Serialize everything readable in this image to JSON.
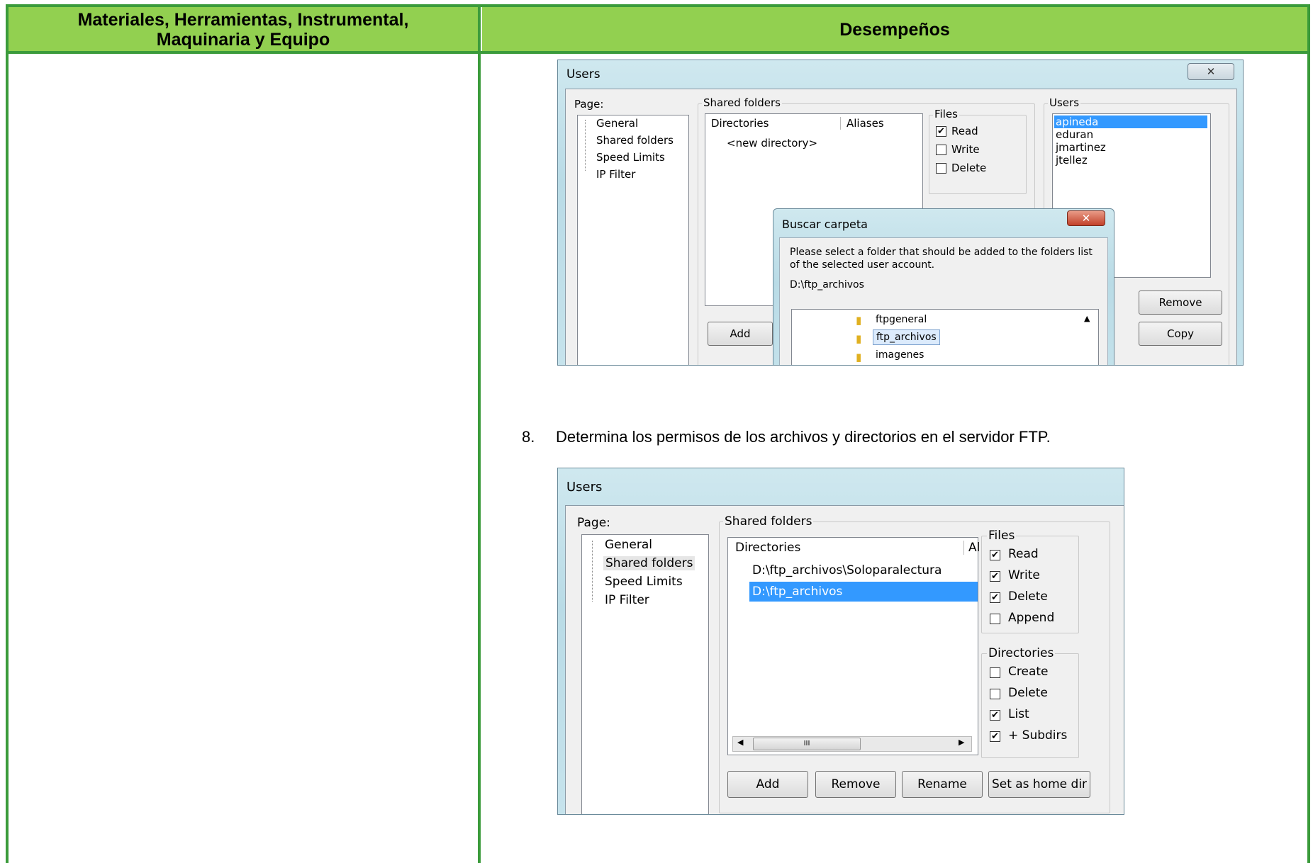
{
  "table": {
    "header_left": "Materiales, Herramientas, Instrumental, Maquinaria y Equipo",
    "header_left_line1": "Materiales, Herramientas, Instrumental,",
    "header_left_line2": "Maquinaria y Equipo",
    "header_right": "Desempeños"
  },
  "step8": {
    "number": "8.",
    "text": "Determina los permisos de los archivos y directorios en el servidor FTP."
  },
  "shot1": {
    "title": "Users",
    "page_label": "Page:",
    "pages": [
      "General",
      "Shared folders",
      "Speed Limits",
      "IP Filter"
    ],
    "shared_folders_label": "Shared folders",
    "col_directories": "Directories",
    "col_aliases": "Aliases",
    "new_directory": "<new directory>",
    "files_label": "Files",
    "files": [
      {
        "label": "Read",
        "checked": true
      },
      {
        "label": "Write",
        "checked": false
      },
      {
        "label": "Delete",
        "checked": false
      }
    ],
    "users_label": "Users",
    "users": [
      "apineda",
      "eduran",
      "jmartinez",
      "jtellez"
    ],
    "add_button": "Add",
    "remove_button": "Remove",
    "copy_button": "Copy",
    "dialog": {
      "title": "Buscar carpeta",
      "message_line1": "Please select a folder that should be added to the folders list",
      "message_line2": "of the selected user account.",
      "path": "D:\\ftp_archivos",
      "folders": [
        "ftpgeneral",
        "ftp_archivos",
        "imagenes"
      ]
    }
  },
  "shot2": {
    "title": "Users",
    "page_label": "Page:",
    "pages": [
      "General",
      "Shared folders",
      "Speed Limits",
      "IP Filter"
    ],
    "shared_folders_label": "Shared folders",
    "col_directories": "Directories",
    "col_aliases": "Al",
    "directories": [
      "D:\\ftp_archivos\\Soloparalectura",
      "D:\\ftp_archivos"
    ],
    "files_label": "Files",
    "files": [
      {
        "label": "Read",
        "checked": true
      },
      {
        "label": "Write",
        "checked": true
      },
      {
        "label": "Delete",
        "checked": true
      },
      {
        "label": "Append",
        "checked": false
      }
    ],
    "directories_label": "Directories",
    "dir_perms": [
      {
        "label": "Create",
        "checked": false
      },
      {
        "label": "Delete",
        "checked": false
      },
      {
        "label": "List",
        "checked": true
      },
      {
        "label": "+ Subdirs",
        "checked": true
      }
    ],
    "scroll_label": "III",
    "buttons": [
      "Add",
      "Remove",
      "Rename",
      "Set as home dir"
    ]
  }
}
